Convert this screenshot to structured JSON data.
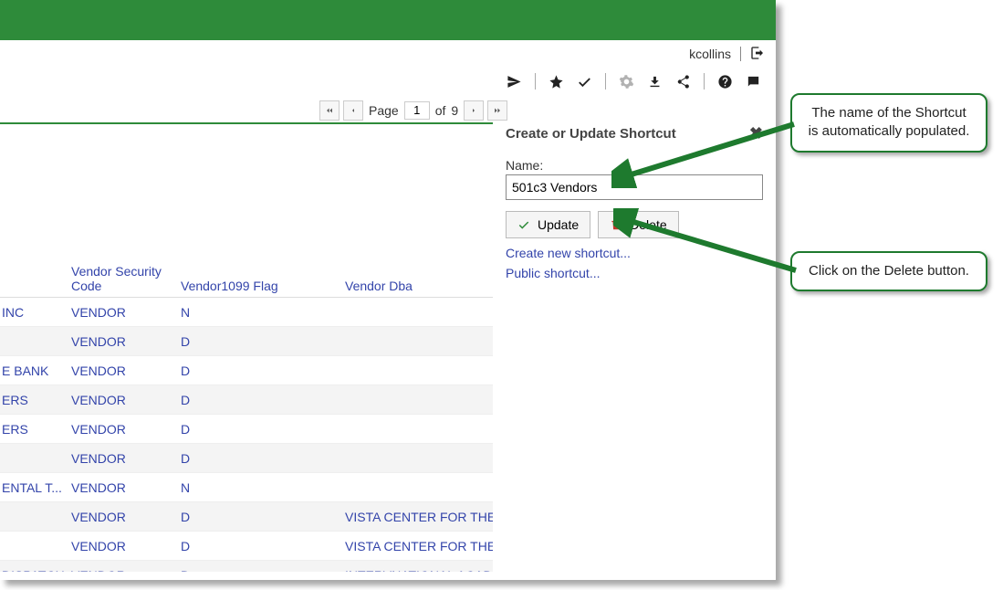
{
  "user": {
    "name": "kcollins"
  },
  "pager": {
    "prefix": "Page",
    "current": "1",
    "of_label": "of",
    "total": "9"
  },
  "panel": {
    "title": "Create or Update Shortcut",
    "name_label": "Name:",
    "name_value": "501c3 Vendors",
    "update_label": "Update",
    "delete_label": "Delete",
    "create_link": "Create new shortcut...",
    "public_link": "Public shortcut..."
  },
  "table": {
    "headers": {
      "col0": "",
      "col1": "Vendor Security Code",
      "col2": "Vendor1099 Flag",
      "col3": "Vendor Dba"
    },
    "rows": [
      {
        "c0": "INC",
        "c1": "VENDOR",
        "c2": "N",
        "c3": ""
      },
      {
        "c0": "",
        "c1": "VENDOR",
        "c2": "D",
        "c3": ""
      },
      {
        "c0": "E BANK",
        "c1": "VENDOR",
        "c2": "D",
        "c3": ""
      },
      {
        "c0": "ERS",
        "c1": "VENDOR",
        "c2": "D",
        "c3": ""
      },
      {
        "c0": "ERS",
        "c1": "VENDOR",
        "c2": "D",
        "c3": ""
      },
      {
        "c0": "",
        "c1": "VENDOR",
        "c2": "D",
        "c3": ""
      },
      {
        "c0": "ENTAL T...",
        "c1": "VENDOR",
        "c2": "N",
        "c3": ""
      },
      {
        "c0": "",
        "c1": "VENDOR",
        "c2": "D",
        "c3": "VISTA CENTER FOR THE"
      },
      {
        "c0": "",
        "c1": "VENDOR",
        "c2": "D",
        "c3": "VISTA CENTER FOR THE"
      },
      {
        "c0": "DISPATCH",
        "c1": "VENDOR",
        "c2": "D",
        "c3": "INTERVNATIONAL ACAD"
      }
    ]
  },
  "callouts": {
    "top": "The name of the Shortcut is automatically populated.",
    "bottom": "Click on the Delete button."
  }
}
